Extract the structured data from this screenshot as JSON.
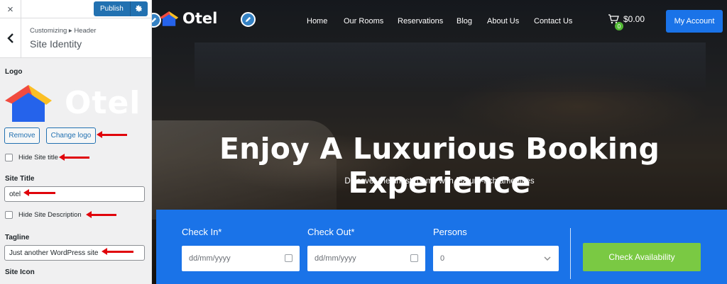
{
  "customizer": {
    "close_label": "×",
    "publish_label": "Publish",
    "breadcrumb": "Customizing ▸ Header",
    "section_title": "Site Identity",
    "logo_label": "Logo",
    "logo_preview_text": "Otel",
    "remove_label": "Remove",
    "change_logo_label": "Change logo",
    "hide_title_label": "Hide Site title",
    "site_title_label": "Site Title",
    "site_title_value": "otel",
    "hide_description_label": "Hide Site Description",
    "tagline_label": "Tagline",
    "tagline_value": "Just another WordPress site",
    "site_icon_label": "Site Icon"
  },
  "site": {
    "logo_text": "Otel",
    "nav": [
      "Home",
      "Our Rooms",
      "Reservations",
      "Blog",
      "About Us",
      "Contact Us"
    ],
    "cart_total": "$0.00",
    "cart_count": "0",
    "account_label": "My Account",
    "hero_title": "Enjoy A Luxurious Booking Experience",
    "hero_subtitle": "Discover the finest rooms with feature-rich amenities"
  },
  "booking": {
    "checkin_label": "Check In*",
    "checkin_placeholder": "dd/mm/yyyy",
    "checkout_label": "Check Out*",
    "checkout_placeholder": "dd/mm/yyyy",
    "persons_label": "Persons",
    "persons_value": "0",
    "submit_label": "Check Availability"
  },
  "colors": {
    "wp_blue": "#2271b1",
    "site_blue": "#1a73e8",
    "green": "#7ac943",
    "annotation_red": "#e0040b"
  }
}
